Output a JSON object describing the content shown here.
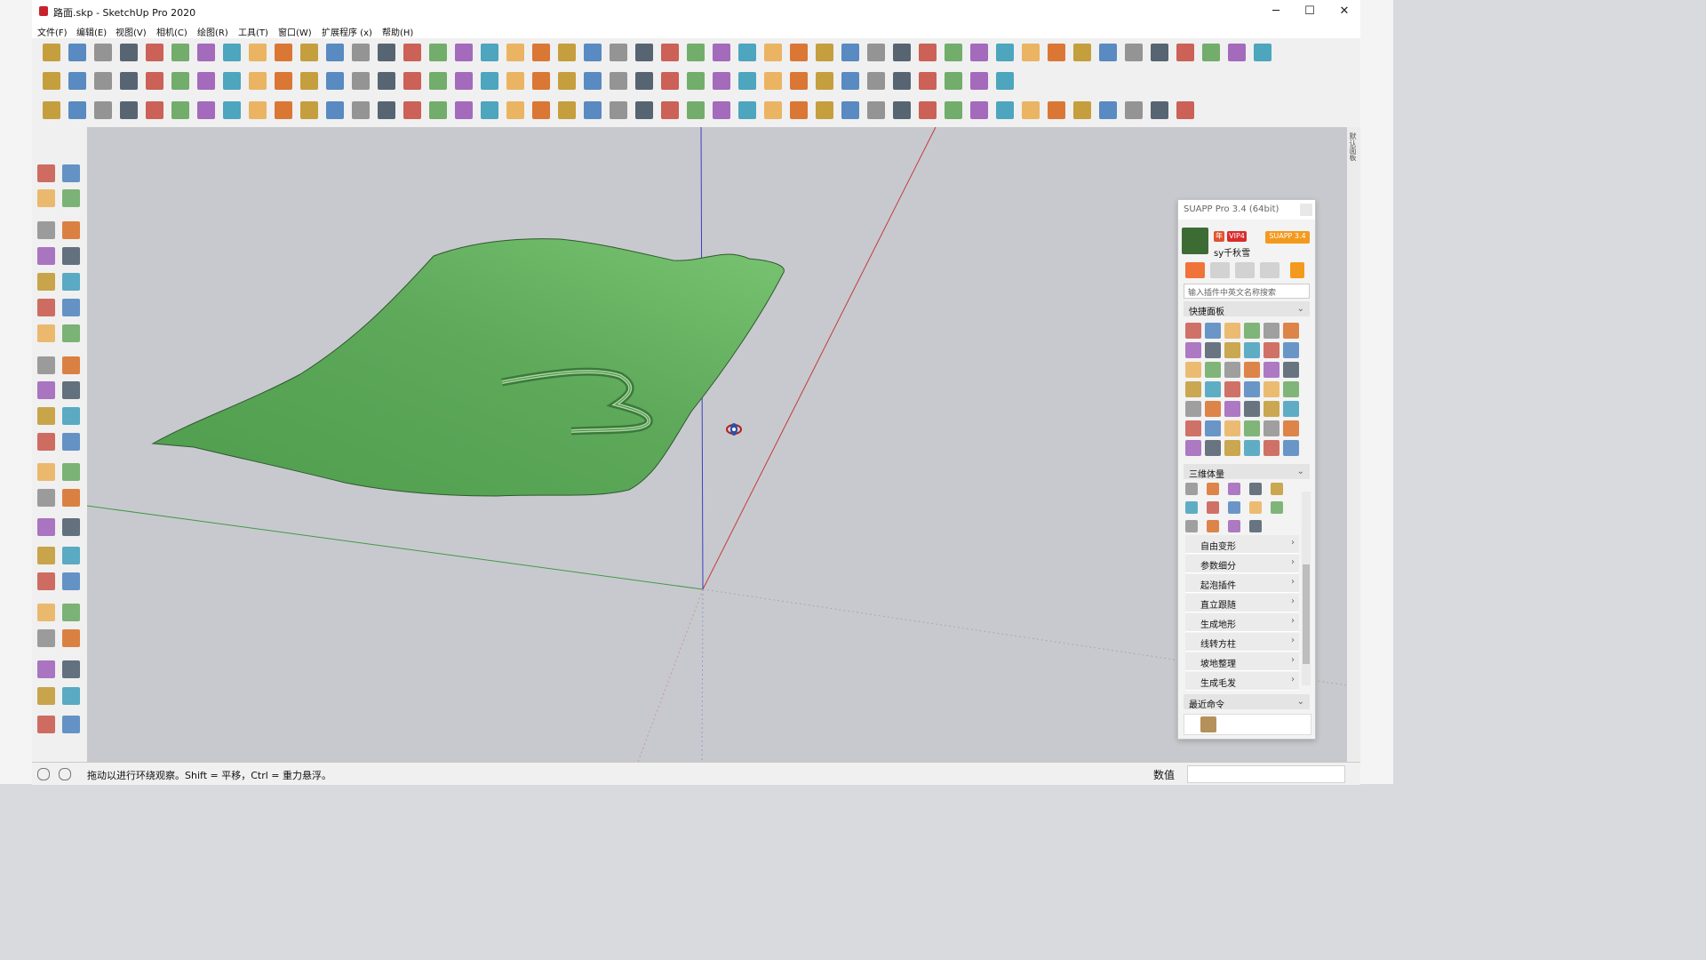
{
  "window": {
    "title": "路面.skp - SketchUp Pro 2020",
    "minimize": "─",
    "maximize": "☐",
    "close": "✕"
  },
  "menu": [
    "文件(F)",
    "编辑(E)",
    "视图(V)",
    "相机(C)",
    "绘图(R)",
    "工具(T)",
    "窗口(W)",
    "扩展程序 (x)",
    "帮助(H)"
  ],
  "colors": {
    "terrain": "#5ea95a",
    "terrain_dark": "#3f8a3f",
    "viewport": "#c8c9ce",
    "axis_blue": "#3a40c0",
    "axis_red": "#c23b3b",
    "axis_green": "#3f9a4a",
    "suapp_orange": "#f39a1e"
  },
  "panel": {
    "title": "SUAPP Pro 3.4 (64bit)",
    "badge_year": "年",
    "badge_vip": "VIP4",
    "badge_suapp": "SUAPP 3.4",
    "username": "sy千秋雪",
    "search_placeholder": "输入插件中英文名称搜索",
    "quick_panel": "快捷面板",
    "volume_section": "三维体量",
    "items": [
      "自由变形",
      "参数细分",
      "起泡插件",
      "直立跟随",
      "生成地形",
      "线转方柱",
      "坡地整理",
      "生成毛发"
    ],
    "recent": "最近命令"
  },
  "right_tab": "默认面板",
  "status": {
    "hint": "拖动以进行环绕观察。Shift = 平移，Ctrl = 重力悬浮。",
    "value_label": "数值",
    "value": ""
  }
}
